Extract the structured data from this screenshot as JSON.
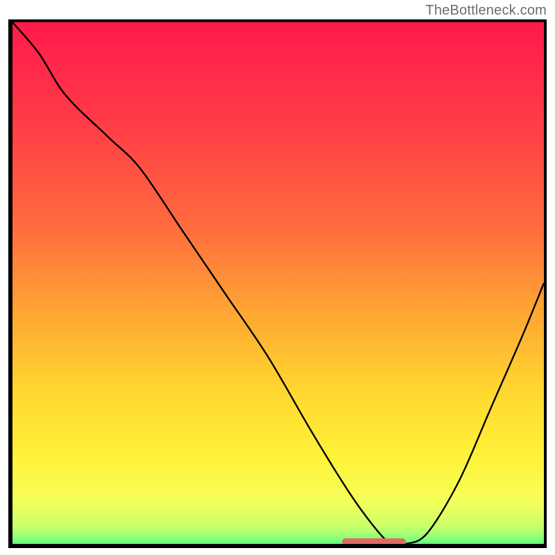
{
  "watermark": "TheBottleneck.com",
  "chart_data": {
    "type": "line",
    "title": "",
    "xlabel": "",
    "ylabel": "",
    "xlim": [
      0,
      100
    ],
    "ylim": [
      0,
      100
    ],
    "x": [
      0,
      5,
      10,
      18,
      24,
      32,
      40,
      48,
      56,
      62,
      66,
      70,
      72,
      74,
      78,
      84,
      90,
      96,
      100
    ],
    "y": [
      100,
      94,
      86,
      78,
      72,
      60,
      48,
      36,
      22,
      12,
      6,
      1,
      0,
      0,
      2,
      12,
      26,
      40,
      50
    ],
    "gradient_stops": [
      {
        "pos": 0.0,
        "color": "#ff1a4a"
      },
      {
        "pos": 0.18,
        "color": "#ff3a48"
      },
      {
        "pos": 0.38,
        "color": "#ff6a3e"
      },
      {
        "pos": 0.55,
        "color": "#ffa733"
      },
      {
        "pos": 0.7,
        "color": "#ffd92f"
      },
      {
        "pos": 0.82,
        "color": "#fff23a"
      },
      {
        "pos": 0.9,
        "color": "#f6ff5a"
      },
      {
        "pos": 0.95,
        "color": "#c8ff6a"
      },
      {
        "pos": 0.975,
        "color": "#7dff7d"
      },
      {
        "pos": 1.0,
        "color": "#00e06b"
      }
    ],
    "marker": {
      "x_start": 62,
      "x_end": 74,
      "y": 0.5,
      "color": "#e16a62"
    },
    "annotations": []
  }
}
